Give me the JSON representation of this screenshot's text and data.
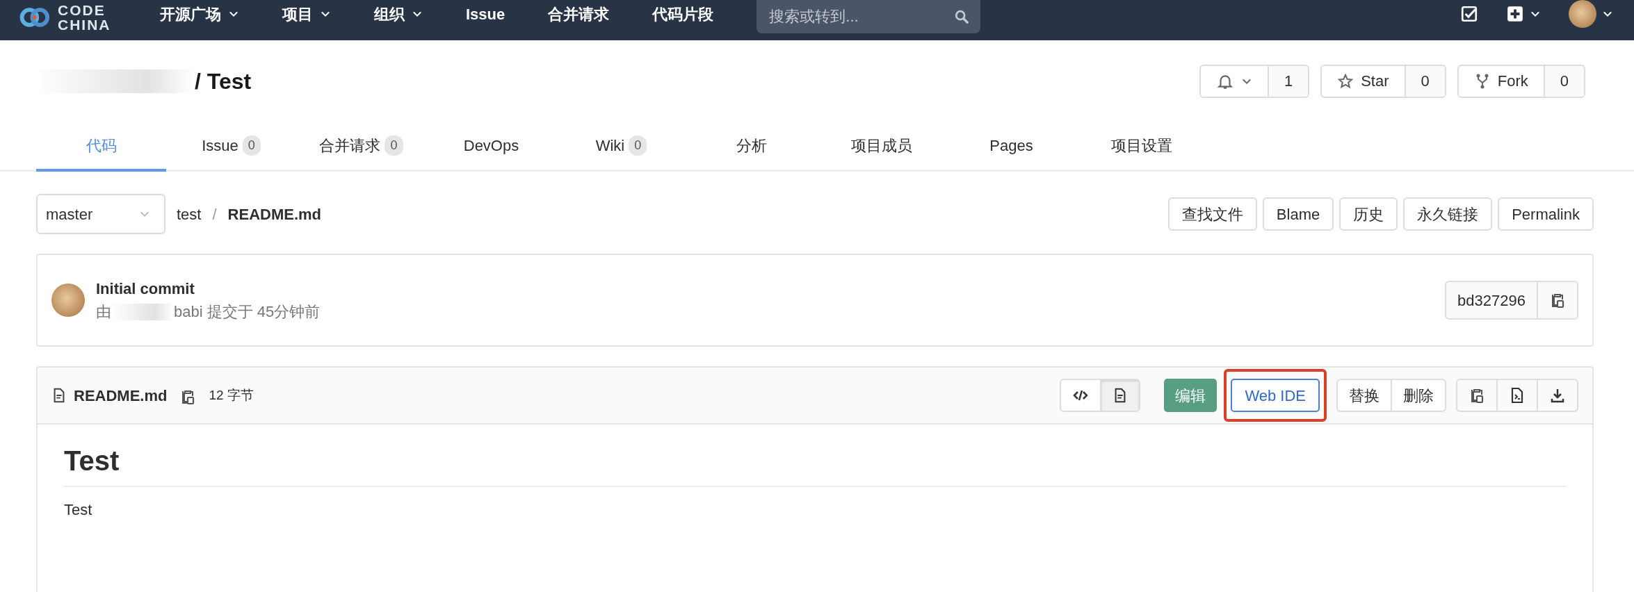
{
  "navbar": {
    "logo": [
      "CODE",
      "CHINA"
    ],
    "items": [
      {
        "label": "开源广场",
        "dropdown": true
      },
      {
        "label": "项目",
        "dropdown": true
      },
      {
        "label": "组织",
        "dropdown": true
      },
      {
        "label": "Issue",
        "dropdown": false
      },
      {
        "label": "合并请求",
        "dropdown": false
      },
      {
        "label": "代码片段",
        "dropdown": false
      }
    ],
    "search": {
      "placeholder": "搜索或转到..."
    }
  },
  "project": {
    "title": "/ Test",
    "notifications": "1",
    "star": {
      "label": "Star",
      "count": "0"
    },
    "fork": {
      "label": "Fork",
      "count": "0"
    }
  },
  "tabs": [
    {
      "label": "代码",
      "selected": true
    },
    {
      "label": "Issue",
      "count": "0",
      "selected": false
    },
    {
      "label": "合并请求",
      "count": "0",
      "selected": false
    },
    {
      "label": "DevOps",
      "selected": false
    },
    {
      "label": "Wiki",
      "count": "0",
      "selected": false
    },
    {
      "label": "分析",
      "selected": false
    },
    {
      "label": "项目成员",
      "selected": false
    },
    {
      "label": "Pages",
      "selected": false
    },
    {
      "label": "项目设置",
      "selected": false
    }
  ],
  "breadcrumb": {
    "branch": "master",
    "folder": "test",
    "separator": "/",
    "file": "README.md"
  },
  "file_actions": [
    "查找文件",
    "Blame",
    "历史",
    "永久链接",
    "Permalink"
  ],
  "commit": {
    "title": "Initial commit",
    "by": "由",
    "meta": "babi 提交于 45分钟前",
    "sha": "bd327296"
  },
  "file": {
    "name": "README.md",
    "size": "12 字节",
    "view_modes": [
      {
        "kind": "source",
        "selected": false
      },
      {
        "kind": "rendered",
        "selected": true
      }
    ],
    "edit": "编辑",
    "web_ide": {
      "label": "Web IDE",
      "highlighted": true
    },
    "changes": [
      "替换",
      "删除"
    ]
  },
  "readme": {
    "heading": "Test",
    "body": "Test"
  }
}
